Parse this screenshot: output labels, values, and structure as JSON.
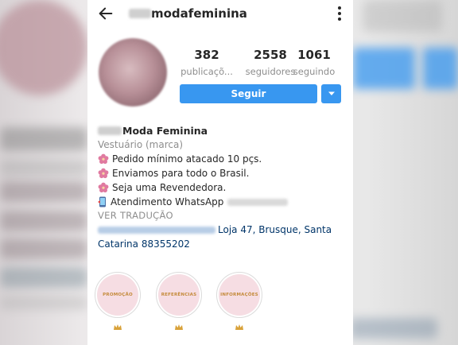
{
  "header": {
    "username": "modafeminina"
  },
  "profile": {
    "stats": [
      {
        "value": "382",
        "label": "publicaçõ..."
      },
      {
        "value": "2558",
        "label": "seguidores"
      },
      {
        "value": "1061",
        "label": "seguindo"
      }
    ],
    "follow_label": "Seguir"
  },
  "bio": {
    "name": "Moda Feminina",
    "category": "Vestuário (marca)",
    "lines": [
      "Pedido mínimo atacado 10 pçs.",
      "Enviamos para todo o Brasil.",
      "Seja uma Revendedora.",
      "Atendimento WhatsApp"
    ],
    "translate_label": "VER TRADUÇÃO",
    "address_line1": "Loja 47, Brusque, Santa",
    "address_line2": "Catarina 88355202"
  },
  "highlights": [
    {
      "label": "PROMOÇÃO"
    },
    {
      "label": "REFERÊNCIAS"
    },
    {
      "label": "INFORMAÇÕES"
    }
  ],
  "colors": {
    "accent": "#3897f0",
    "link": "#003569",
    "muted": "#8e8e8e",
    "flower": "#e07aa0",
    "highlight_bg": "#f6dde3"
  },
  "icons": {
    "back": "back-arrow-icon",
    "more": "more-vertical-icon",
    "dropdown": "chevron-down-icon",
    "flower": "cherry-blossom-icon",
    "phone": "mobile-phone-icon"
  }
}
